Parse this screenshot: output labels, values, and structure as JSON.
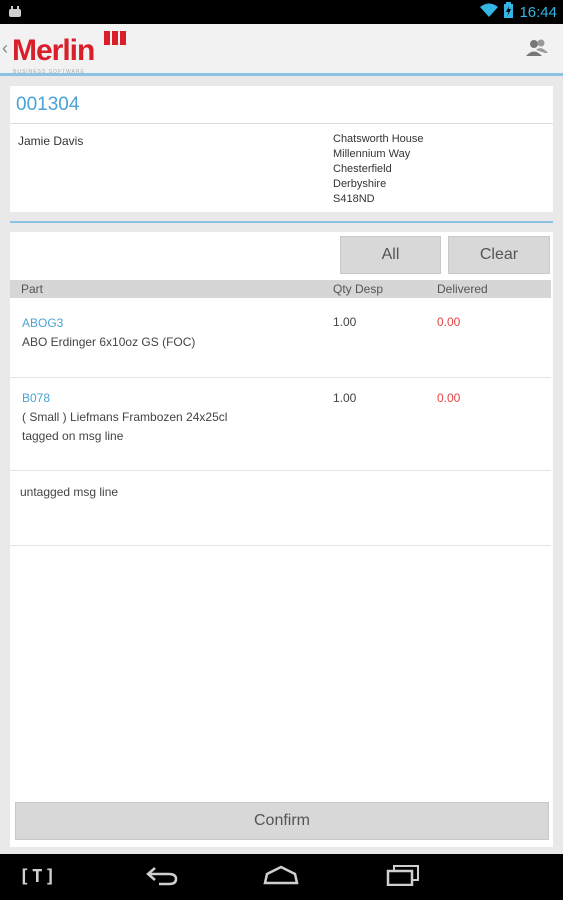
{
  "status_bar": {
    "time": "16:44"
  },
  "app": {
    "logo_text": "Merlin",
    "logo_subtext": "BUSINESS SOFTWARE"
  },
  "order": {
    "number": "001304",
    "customer_name": "Jamie Davis",
    "address_lines": [
      "Chatsworth House",
      "Millennium Way",
      "Chesterfield",
      "Derbyshire",
      "S418ND"
    ]
  },
  "actions": {
    "all_label": "All",
    "clear_label": "Clear",
    "confirm_label": "Confirm"
  },
  "table": {
    "headers": {
      "part": "Part",
      "qty": "Qty Desp",
      "delivered": "Delivered"
    },
    "rows": [
      {
        "code": "ABOG3",
        "description_lines": [
          "ABO Erdinger 6x10oz GS (FOC)"
        ],
        "qty": "1.00",
        "delivered": "0.00"
      },
      {
        "code": "B078",
        "description_lines": [
          "( Small )  Liefmans Frambozen 24x25cl",
          "tagged on msg line"
        ],
        "qty": "1.00",
        "delivered": "0.00"
      }
    ],
    "message_row": "untagged msg line"
  },
  "nav": {
    "t_label": "[T]"
  },
  "colors": {
    "accent": "#4aa3d4",
    "brand": "#d81f2a",
    "negative": "#e04545",
    "divider": "#8cc3e3"
  }
}
